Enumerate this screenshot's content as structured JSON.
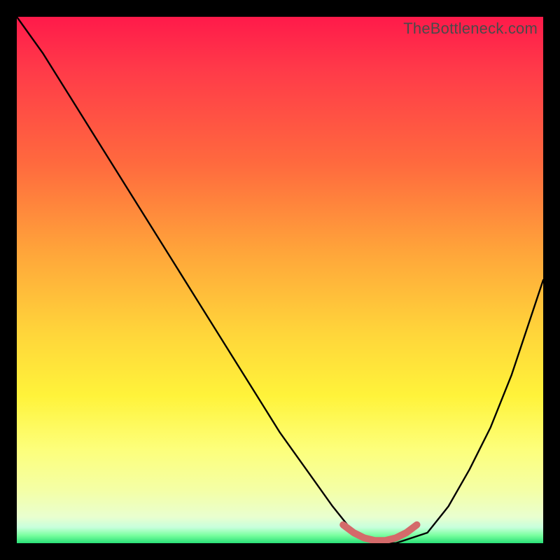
{
  "watermark": "TheBottleneck.com",
  "chart_data": {
    "type": "line",
    "title": "",
    "xlabel": "",
    "ylabel": "",
    "xlim": [
      0,
      100
    ],
    "ylim": [
      0,
      100
    ],
    "series": [
      {
        "name": "bottleneck-curve",
        "x": [
          0,
          5,
          10,
          15,
          20,
          25,
          30,
          35,
          40,
          45,
          50,
          55,
          60,
          64,
          68,
          72,
          78,
          82,
          86,
          90,
          94,
          100
        ],
        "values": [
          100,
          93,
          85,
          77,
          69,
          61,
          53,
          45,
          37,
          29,
          21,
          14,
          7,
          2,
          0,
          0,
          2,
          7,
          14,
          22,
          32,
          50
        ]
      },
      {
        "name": "highlight-segment",
        "x": [
          62,
          64,
          66,
          68,
          70,
          72,
          74,
          76
        ],
        "values": [
          3.5,
          2,
          1,
          0.5,
          0.5,
          1,
          2,
          3.5
        ]
      }
    ],
    "annotations": []
  },
  "colors": {
    "curve_main": "#000000",
    "highlight": "#d46a6a"
  }
}
